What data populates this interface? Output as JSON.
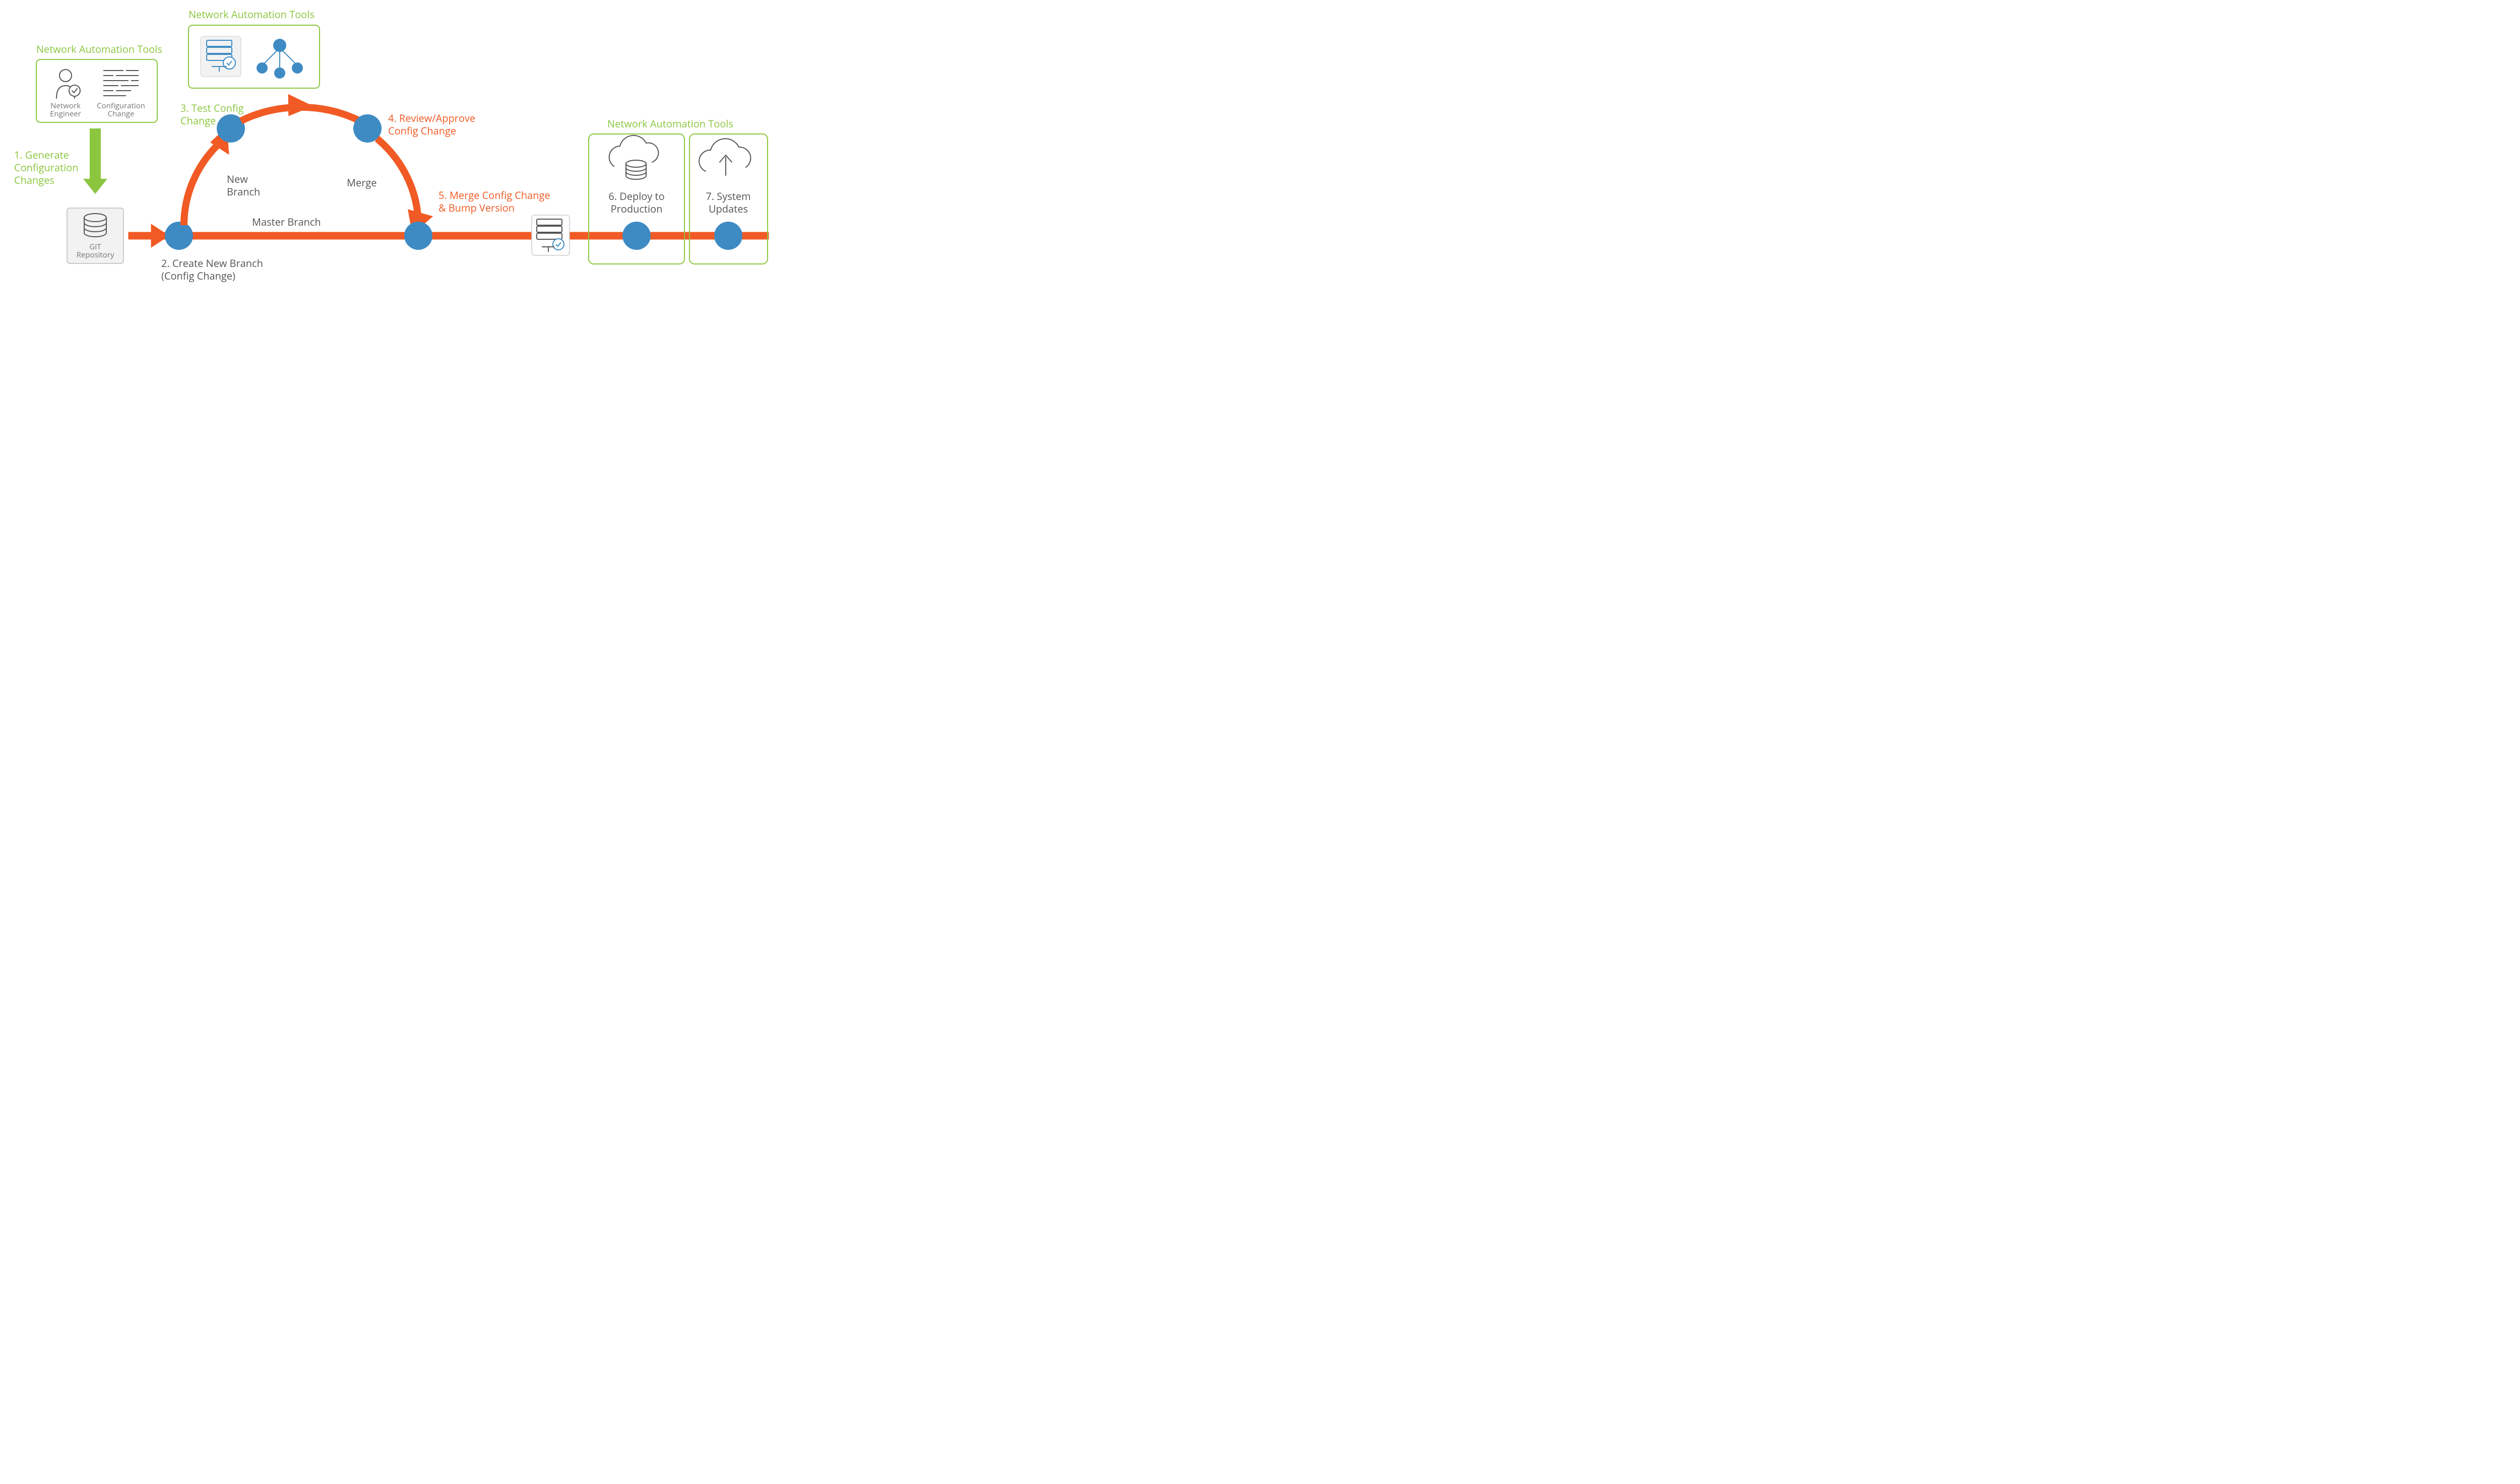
{
  "colors": {
    "green": "#8CC63F",
    "orange": "#F15A24",
    "blue": "#3E8BC4",
    "grayBox": "#F2F2F2",
    "grayText": "#555555"
  },
  "tools_box_1": {
    "title": "Network Automation Tools",
    "icon1_caption": "Network\nEngineer",
    "icon2_caption": "Configuration\nChange"
  },
  "tools_box_2": {
    "title": "Network Automation Tools"
  },
  "tools_box_3": {
    "title": "Network Automation Tools"
  },
  "steps": {
    "s1": "1. Generate\nConfiguration\nChanges",
    "s2": "2. Create New Branch\n(Config Change)",
    "s3": "3. Test Config\nChange",
    "s4": "4. Review/Approve\nConfig Change",
    "s5": "5. Merge Config Change\n& Bump Version",
    "s6": "6. Deploy to\nProduction",
    "s7": "7. System\nUpdates"
  },
  "labels": {
    "new_branch": "New\nBranch",
    "master_branch": "Master Branch",
    "merge": "Merge",
    "git_repo": "GIT\nRepository"
  }
}
